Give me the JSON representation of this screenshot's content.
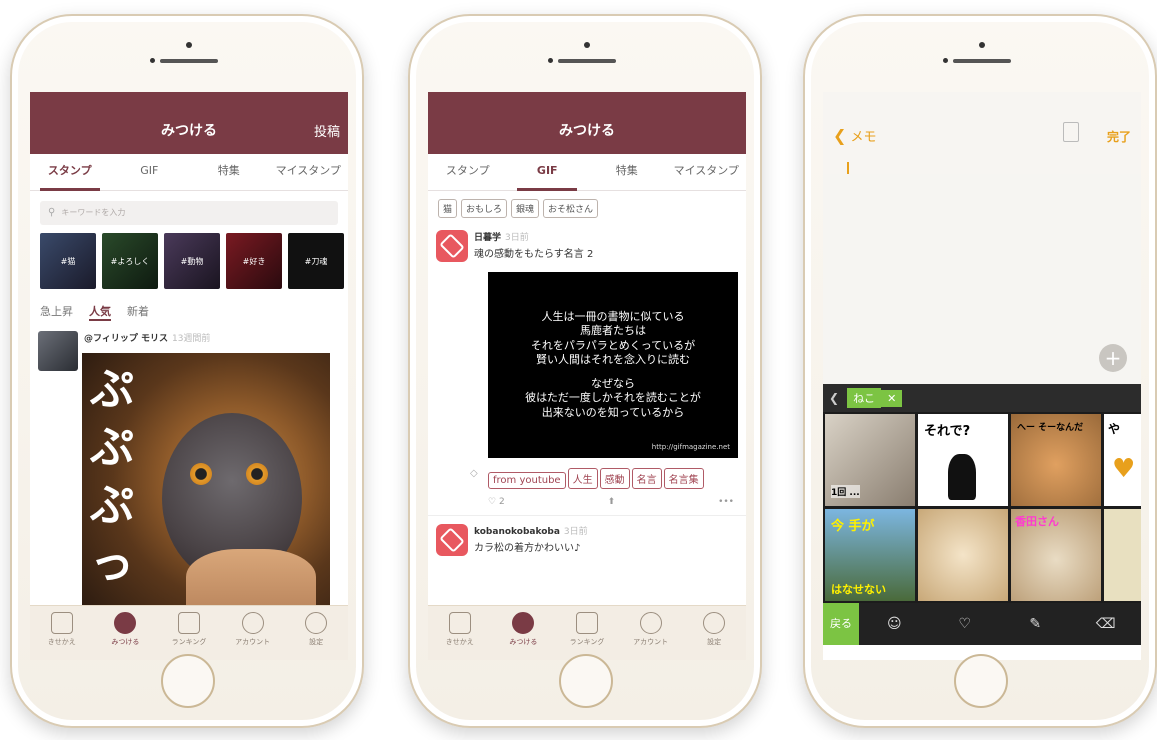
{
  "phone1": {
    "header_title": "みつける",
    "header_post": "投稿",
    "tabs": [
      "スタンプ",
      "GIF",
      "特集",
      "マイスタンプ"
    ],
    "active_tab": "スタンプ",
    "search_placeholder": "キーワードを入力",
    "thumbs": [
      "#猫",
      "#よろしく",
      "#動物",
      "#好き",
      "#刀魂"
    ],
    "sort": [
      "急上昇",
      "人気",
      "新着"
    ],
    "post_user": "@フィリップ モリス",
    "post_time": "13週間前",
    "big_text": [
      "ぷ",
      "ぷ",
      "ぷ",
      "っ"
    ],
    "tabbar": [
      "きせかえ",
      "みつける",
      "ランキング",
      "アカウント",
      "設定"
    ]
  },
  "phone2": {
    "header_title": "みつける",
    "tabs": [
      "スタンプ",
      "GIF",
      "特集",
      "マイスタンプ"
    ],
    "active_tab": "GIF",
    "chips": [
      "猫",
      "おもしろ",
      "銀魂",
      "おそ松さん"
    ],
    "post1_user": "日暮学",
    "post1_time": "3日前",
    "post1_text": "魂の感動をもたらす名言 2",
    "quote_lines": [
      "人生は一冊の書物に似ている",
      "馬鹿者たちは",
      "それをパラパラとめくっているが",
      "賢い人間はそれを念入りに読む",
      "",
      "なぜなら",
      "彼はただ一度しかそれを読むことが",
      "出来ないのを知っているから"
    ],
    "quote_url": "http://gifmagazine.net",
    "tags": [
      "from youtube",
      "人生",
      "感動",
      "名言",
      "名言集"
    ],
    "like_count": "2",
    "more": "•••",
    "post2_user": "kobanokobakoba",
    "post2_time": "3日前",
    "post2_text": "カラ松の着方かわいい♪",
    "tabbar": [
      "きせかえ",
      "みつける",
      "ランキング",
      "アカウント",
      "設定"
    ]
  },
  "phone3": {
    "back_label": "メモ",
    "done_label": "完了",
    "keyboard_tag": "ねこ",
    "keyboard_close": "✕",
    "stickers": [
      "1回 ...",
      "それで?",
      "へー そーなんだ",
      "や",
      "今 手が",
      "",
      "香田さん",
      "はなせない"
    ],
    "kb_back": "戻る"
  },
  "colors": {
    "brand": "#7a3b45",
    "accent_orange": "#f0a030",
    "green": "#7cc443"
  }
}
